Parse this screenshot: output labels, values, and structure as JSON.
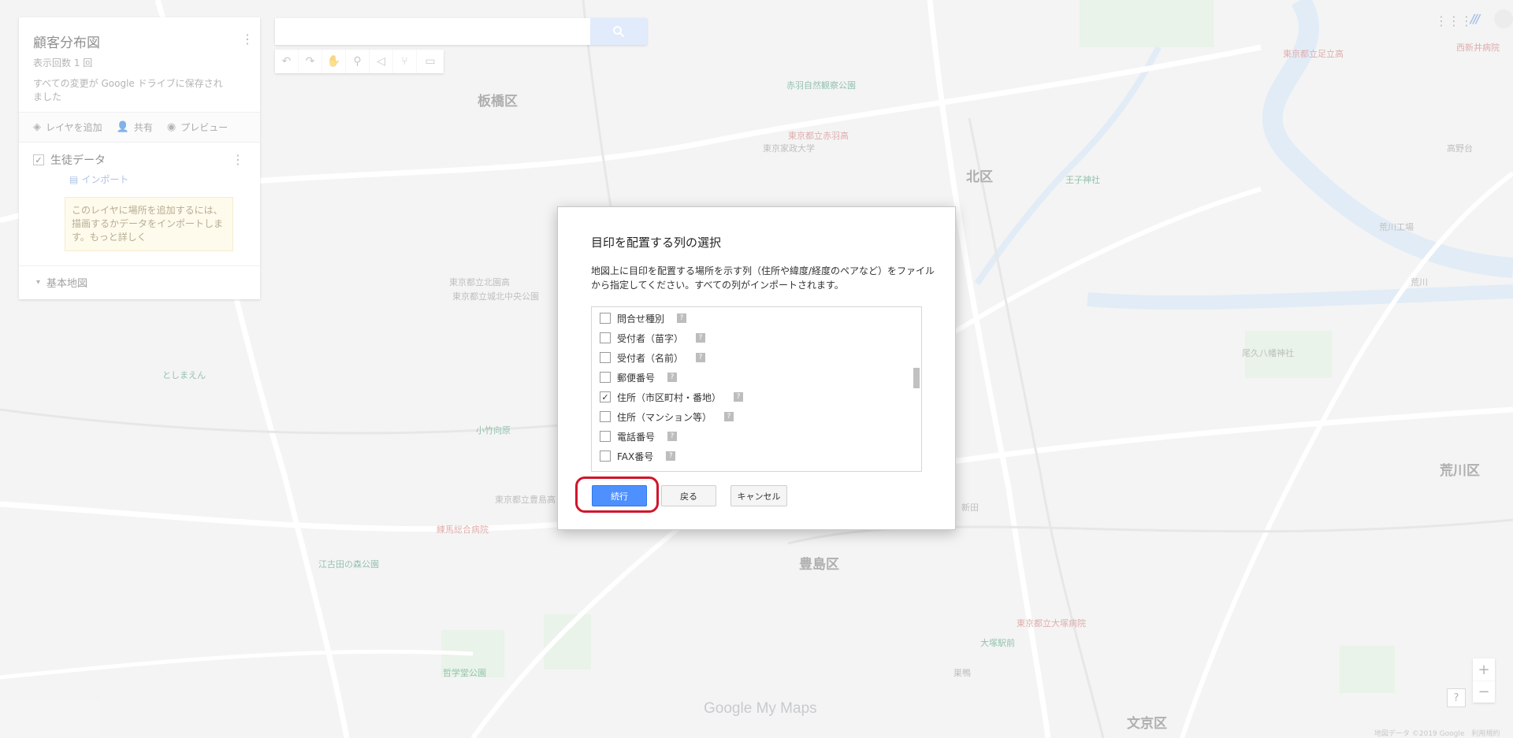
{
  "map": {
    "ward_labels": [
      "板橋区",
      "北区",
      "豊島区",
      "文京区",
      "荒川区"
    ],
    "place_labels": [
      "東京都立赤羽高",
      "東京都立足立高",
      "東京都立北園高",
      "東京都立豊島高",
      "東京都立大塚病院",
      "練馬総合病院",
      "江古田の森公園",
      "哲学堂公園",
      "王子神社",
      "新田",
      "大塚駅前",
      "巣鴨",
      "尾久八幡神社",
      "荒川工場",
      "西新井病院",
      "高野台",
      "としまえん",
      "小竹向原",
      "東京都立城北中央公園",
      "東京家政大学",
      "赤羽自然観察公園",
      "荒川"
    ],
    "watermark_brand": "Google",
    "watermark_product": "My Maps",
    "copyright": "地図データ ©2019 Google　利用規約"
  },
  "panel": {
    "title": "顧客分布図",
    "views": "表示回数 1 回",
    "save_note": "すべての変更が Google ドライブに保存されました",
    "actions": {
      "add_layer": "レイヤを追加",
      "share": "共有",
      "preview": "プレビュー"
    },
    "layer": {
      "name": "生徒データ",
      "import": "インポート",
      "hint": "このレイヤに場所を追加するには、描画するかデータをインポートします。もっと詳しく"
    },
    "base_map": "基本地図"
  },
  "search": {
    "placeholder": ""
  },
  "dialog": {
    "title": "目印を配置する列の選択",
    "description": "地図上に目印を配置する場所を示す列（住所や緯度/経度のペアなど）をファイルから指定してください。すべての列がインポートされます。",
    "columns": [
      {
        "label": "問合せ種別",
        "checked": false
      },
      {
        "label": "受付者（苗字）",
        "checked": false
      },
      {
        "label": "受付者（名前）",
        "checked": false
      },
      {
        "label": "郵便番号",
        "checked": false
      },
      {
        "label": "住所（市区町村・番地）",
        "checked": true
      },
      {
        "label": "住所（マンション等）",
        "checked": false
      },
      {
        "label": "電話番号",
        "checked": false
      },
      {
        "label": "FAX番号",
        "checked": false
      }
    ],
    "help_glyph": "?",
    "continue_label": "続行",
    "back_label": "戻る",
    "cancel_label": "キャンセル"
  },
  "colors": {
    "primary_button": "#4d90fe",
    "highlight_ring": "#d0162a",
    "map_base": "#e9e9e9",
    "map_water": "#cbdcef",
    "map_park": "#d8ead7"
  }
}
